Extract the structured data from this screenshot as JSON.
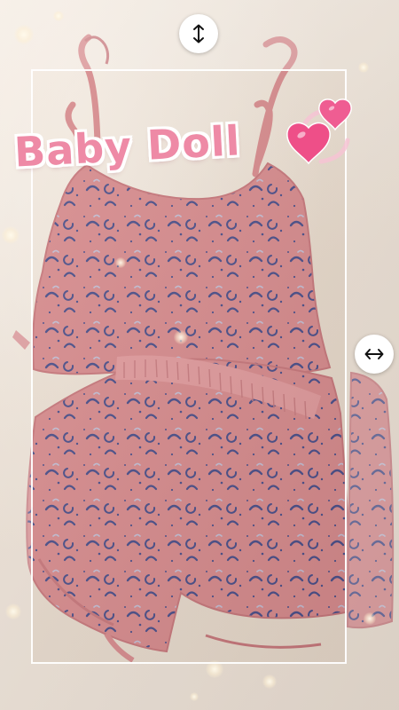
{
  "sticker": {
    "title": "Baby Doll",
    "color": "#ee8aa6",
    "outline_color": "#ffffff",
    "emoji": "two-hearts"
  },
  "garment": {
    "fabric_color": "#d98c8e",
    "print_color": "#4b4f8a"
  },
  "controls": {
    "vertical_resize_icon": "vertical-arrows-icon",
    "horizontal_resize_icon": "horizontal-arrows-icon"
  }
}
